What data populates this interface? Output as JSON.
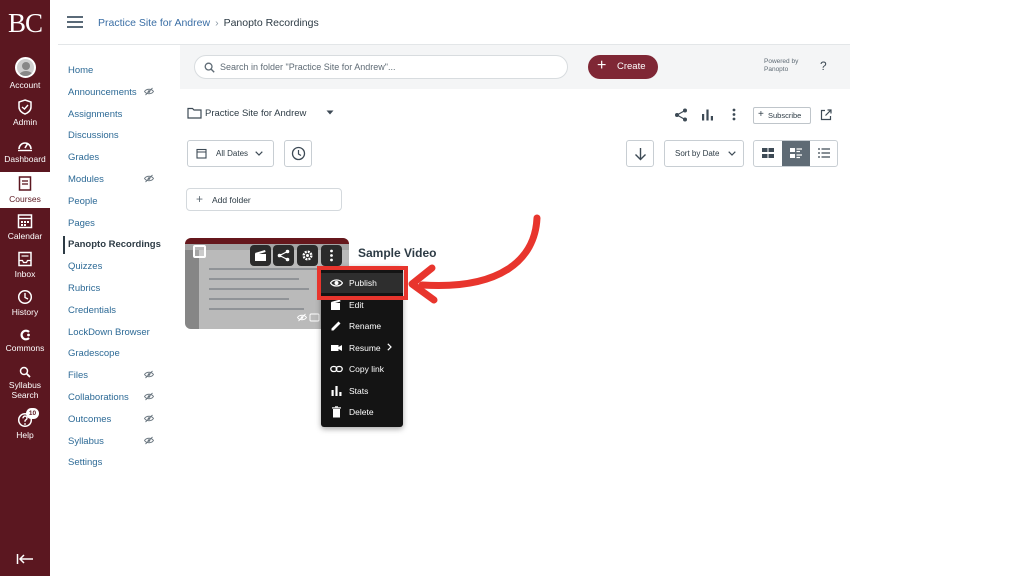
{
  "global_nav": {
    "logo": "BC",
    "items": [
      {
        "label": "Account",
        "icon": "avatar"
      },
      {
        "label": "Admin",
        "icon": "shield-icon"
      },
      {
        "label": "Dashboard",
        "icon": "dashboard-icon"
      },
      {
        "label": "Courses",
        "icon": "book-icon"
      },
      {
        "label": "Calendar",
        "icon": "calendar-icon"
      },
      {
        "label": "Inbox",
        "icon": "inbox-icon"
      },
      {
        "label": "History",
        "icon": "clock-icon"
      },
      {
        "label": "Commons",
        "icon": "commons-icon"
      },
      {
        "label": "Syllabus",
        "label2": "Search",
        "icon": "search-icon"
      },
      {
        "label": "Help",
        "icon": "help-icon",
        "badge": "10"
      }
    ],
    "active": "Courses",
    "colors": {
      "background": "#5b1720",
      "text": "#ffffff"
    }
  },
  "breadcrumb": {
    "course": "Practice Site for Andrew",
    "page": "Panopto Recordings"
  },
  "course_nav": {
    "items": [
      {
        "label": "Home",
        "hidden": false
      },
      {
        "label": "Announcements",
        "hidden": true
      },
      {
        "label": "Assignments",
        "hidden": false
      },
      {
        "label": "Discussions",
        "hidden": false
      },
      {
        "label": "Grades",
        "hidden": false
      },
      {
        "label": "Modules",
        "hidden": true
      },
      {
        "label": "People",
        "hidden": false
      },
      {
        "label": "Pages",
        "hidden": false
      },
      {
        "label": "Panopto Recordings",
        "hidden": false,
        "active": true
      },
      {
        "label": "Quizzes",
        "hidden": false
      },
      {
        "label": "Rubrics",
        "hidden": false
      },
      {
        "label": "Credentials",
        "hidden": false
      },
      {
        "label": "LockDown Browser",
        "hidden": false
      },
      {
        "label": "Gradescope",
        "hidden": false
      },
      {
        "label": "Files",
        "hidden": true
      },
      {
        "label": "Collaborations",
        "hidden": true
      },
      {
        "label": "Outcomes",
        "hidden": true
      },
      {
        "label": "Syllabus",
        "hidden": true
      },
      {
        "label": "Settings",
        "hidden": false
      }
    ]
  },
  "panopto": {
    "search_placeholder": "Search in folder \"Practice Site for Andrew\"...",
    "create_label": "Create",
    "powered_by_line1": "Powered by",
    "powered_by_line2": "Panopto",
    "help": "?",
    "folder_name": "Practice Site for Andrew",
    "subscribe_label": "Subscribe",
    "dates_filter": "All Dates",
    "sort_label": "Sort by Date",
    "add_folder_label": "Add folder",
    "accent_color": "#7f2735",
    "video": {
      "title": "Sample Video"
    },
    "context_menu": [
      {
        "label": "Publish",
        "icon": "eye-icon"
      },
      {
        "label": "Edit",
        "icon": "edit-icon"
      },
      {
        "label": "Rename",
        "icon": "pencil-icon"
      },
      {
        "label": "Resume",
        "icon": "camera-icon",
        "submenu": true
      },
      {
        "label": "Copy link",
        "icon": "link-icon"
      },
      {
        "label": "Stats",
        "icon": "stats-icon"
      },
      {
        "label": "Delete",
        "icon": "trash-icon"
      }
    ],
    "annotation_color": "#e8352d"
  }
}
